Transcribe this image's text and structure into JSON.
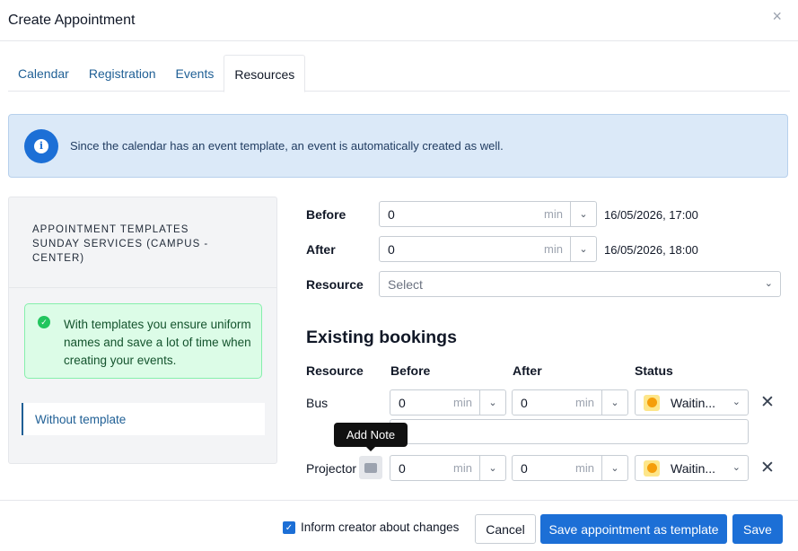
{
  "header": {
    "title": "Create Appointment",
    "close_glyph": "×"
  },
  "tabs": [
    {
      "label": "Calendar"
    },
    {
      "label": "Registration"
    },
    {
      "label": "Events"
    },
    {
      "label": "Resources",
      "active": true
    }
  ],
  "info_banner": {
    "text": "Since the calendar has an event template, an event is automatically created as well.",
    "icon": "info-icon"
  },
  "left_panel": {
    "heading_line1": "APPOINTMENT TEMPLATES",
    "heading_line2": "SUNDAY SERVICES (CAMPUS -",
    "heading_line3": "CENTER)",
    "tip": "With templates you ensure uniform names and save a lot of time when creating your events.",
    "without_template": "Without template"
  },
  "form": {
    "before_label": "Before",
    "before_value": "0",
    "before_unit": "min",
    "before_date": "16/05/2026, 17:00",
    "after_label": "After",
    "after_value": "0",
    "after_unit": "min",
    "after_date": "16/05/2026, 18:00",
    "resource_label": "Resource",
    "resource_placeholder": "Select"
  },
  "bookings": {
    "title": "Existing bookings",
    "columns": [
      "Resource",
      "Before",
      "After",
      "Status"
    ],
    "rows": [
      {
        "resource": "Bus",
        "before": "0",
        "before_unit": "min",
        "after": "0",
        "after_unit": "min",
        "status": "Waitin..."
      },
      {
        "resource": "Projector",
        "before": "0",
        "before_unit": "min",
        "after": "0",
        "after_unit": "min",
        "status": "Waitin..."
      }
    ],
    "tooltip": "Add Note",
    "remove_glyph": "✕"
  },
  "footer": {
    "inform_label": "Inform creator about changes",
    "inform_checked": true,
    "cancel": "Cancel",
    "save_template": "Save appointment as template",
    "save": "Save"
  },
  "colors": {
    "primary": "#1c6fd6",
    "link": "#1f5f95",
    "info_bg": "#dbe9f8",
    "tip_bg": "#dcfce7"
  }
}
